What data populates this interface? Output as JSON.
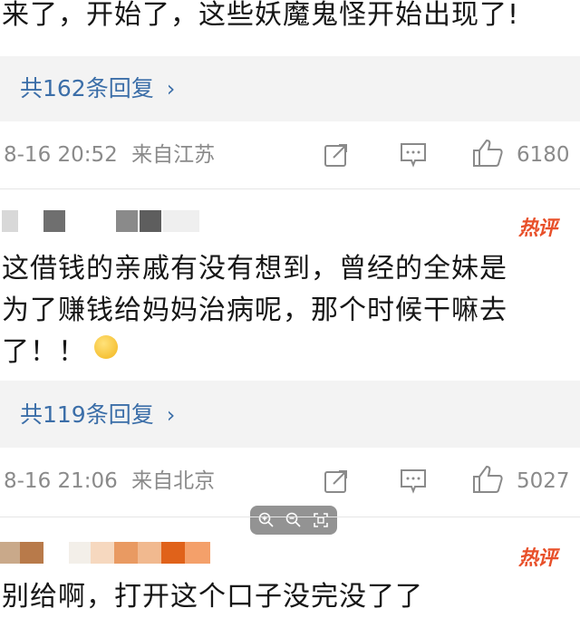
{
  "comments": [
    {
      "text_lines": [
        "来了，开始了，这些妖魔鬼怪开始出现了!"
      ],
      "replies_label": "共162条回复",
      "time": "8-16 20:52",
      "location": "来自江苏",
      "likes": "6180"
    },
    {
      "hot_badge": "热评",
      "text_lines": [
        "这借钱的亲戚有没有想到，曾经的全妹是",
        "为了赚钱给妈妈治病呢，那个时候干嘛去",
        "了！！"
      ],
      "replies_label": "共119条回复",
      "time": "8-16 21:06",
      "location": "来自北京",
      "likes": "5027"
    },
    {
      "hot_badge": "热评",
      "text_lines": [
        "别给啊，打开这个口子没完没了了"
      ]
    }
  ],
  "icons": {
    "share": "share-icon",
    "comment": "comment-icon",
    "like": "thumbs-up-icon",
    "zoom_in": "zoom-in-icon",
    "zoom_out": "zoom-out-icon",
    "fit": "fit-screen-icon",
    "chevron": "chevron-right-icon"
  },
  "colors": {
    "link": "#3b6ea8",
    "hot": "#e8502a",
    "meta": "#8a8a8a"
  }
}
